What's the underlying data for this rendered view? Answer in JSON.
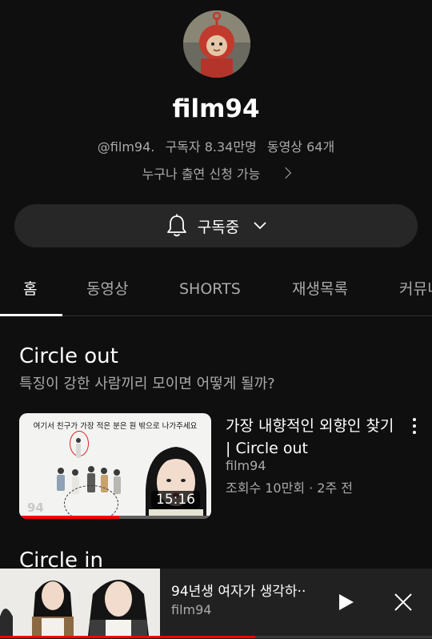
{
  "channel": {
    "name": "film94",
    "handle": "@film94.",
    "subscribers": "구독자 8.34만명",
    "video_count": "동영상 64개",
    "description": "누구나 출연 신청 가능"
  },
  "subscribe": {
    "label": "구독중"
  },
  "tabs": [
    "홈",
    "동영상",
    "SHORTS",
    "재생목록",
    "커뮤니"
  ],
  "section1": {
    "title": "Circle out",
    "subtitle": "특징이 강한 사람끼리 모이면 어떻게 될까?",
    "video": {
      "title_line1": "가장 내향적인 외향인 찾기",
      "title_line2": "| Circle out",
      "channel": "film94",
      "stats": "조회수 10만회 · 2주 전",
      "duration": "15:16",
      "thumb_banner": "여기서 친구가 가장 적은 분은 원 밖으로 나가주세요",
      "thumb_logo": "94",
      "watched_fraction": 0.52
    }
  },
  "section2": {
    "title": "Circle in"
  },
  "miniplayer": {
    "title": "94년생 여자가 생각하··",
    "channel": "film94",
    "progress_fraction": 0.59
  },
  "colors": {
    "accent": "#ff0000",
    "background": "#0f0f0f",
    "secondary_text": "#aaaaaa"
  }
}
